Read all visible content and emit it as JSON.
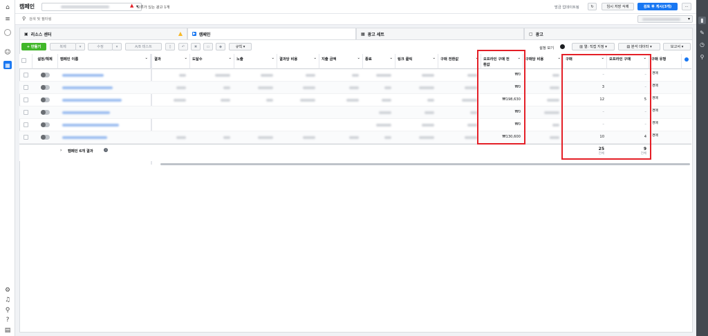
{
  "topbar": {
    "title": "캠페인",
    "error_text": "오류가 있는 광고 1개",
    "updated_text": "방금 업데이트됨",
    "discard_label": "임시 저장 삭제",
    "publish_label": "검토 후 게시(3개)",
    "more_label": "···"
  },
  "search": {
    "placeholder": "검색 및 필터링"
  },
  "tabs": [
    {
      "label": "리소스 센터"
    },
    {
      "label": "캠페인"
    },
    {
      "label": "광고 세트"
    },
    {
      "label": "광고"
    }
  ],
  "toolbar": {
    "create_label": "+ 만들기",
    "duplicate_label": "복제",
    "edit_label": "수정",
    "ab_label": "A/B 테스트",
    "rules_label": "규칙",
    "settings_label": "설정 보기",
    "columns_label": "열: 직접 지정",
    "breakdown_label": "분석 데이터",
    "reports_label": "보고서"
  },
  "table": {
    "columns": [
      "설정/해제",
      "캠페인 이름",
      "결과",
      "도달수",
      "노출",
      "결과당 비용",
      "지출 금액",
      "종료",
      "링크 클릭",
      "구매 전환값",
      "오프라인 구매 전환값",
      "구매당 비용",
      "구매",
      "오프라인 구매",
      "구매 유형"
    ],
    "rows": [
      {
        "offline_value": "₩0",
        "purchases": "–",
        "offline_purchases": "–",
        "type": "경매"
      },
      {
        "offline_value": "₩0",
        "purchases": "3",
        "offline_purchases": "–",
        "type": "경매"
      },
      {
        "offline_value": "₩198,630",
        "purchases": "12",
        "offline_purchases": "5",
        "type": "경매"
      },
      {
        "offline_value": "₩0",
        "purchases": "–",
        "offline_purchases": "–",
        "type": "경매"
      },
      {
        "offline_value": "₩0",
        "purchases": "–",
        "offline_purchases": "–",
        "type": "경매"
      },
      {
        "offline_value": "₩130,600",
        "purchases": "10",
        "offline_purchases": "4",
        "type": "경매"
      }
    ],
    "summary": {
      "label": "캠페인 6개 결과",
      "purchases": "25",
      "purchases_sub": "전체",
      "offline_purchases": "9",
      "offline_purchases_sub": "전체"
    }
  },
  "colors": {
    "accent": "#1877f2",
    "create": "#42b72a",
    "highlight": "#e41e26"
  }
}
